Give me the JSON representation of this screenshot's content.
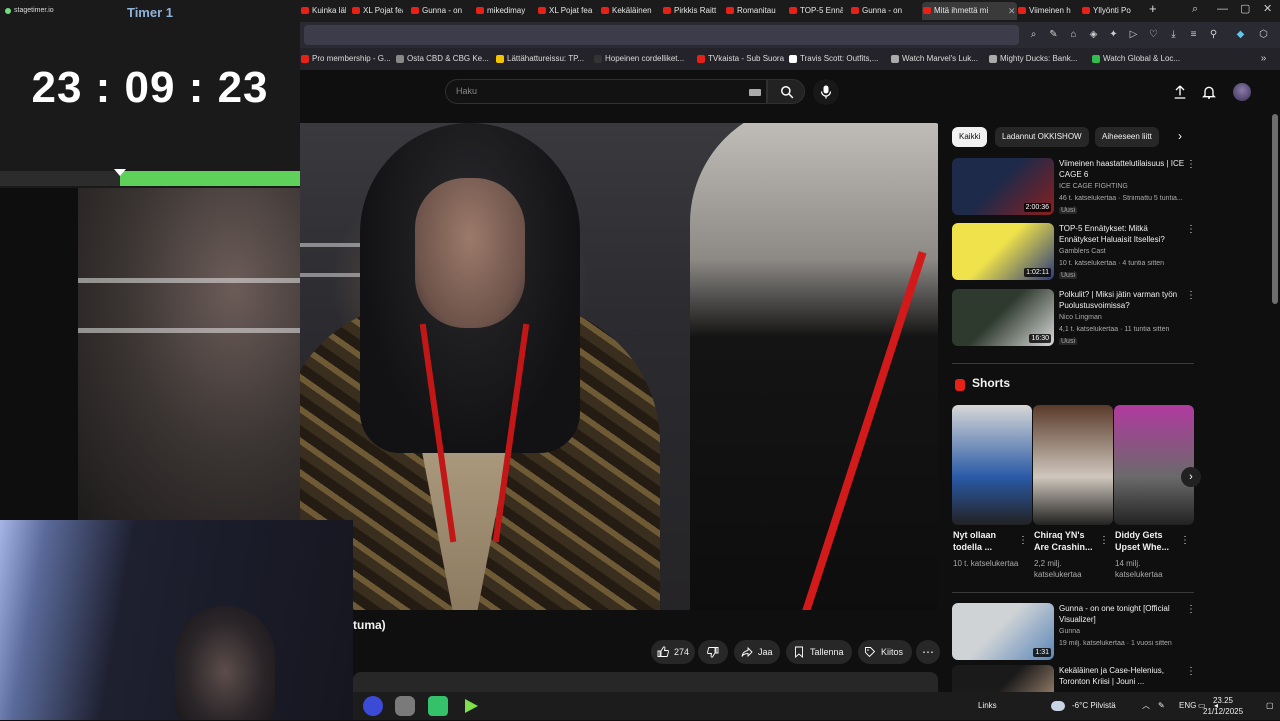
{
  "timer": {
    "brand": "stagetimer.io",
    "title": "Timer 1",
    "time": "23 : 09 : 23",
    "elapsed_fraction": 0.4
  },
  "browser": {
    "tabs": [
      {
        "label": "Kuinka lähe"
      },
      {
        "label": "XL Pojat fea"
      },
      {
        "label": "Gunna - on"
      },
      {
        "label": "mikedimay"
      },
      {
        "label": "XL Pojat fea"
      },
      {
        "label": "Kekäläinen"
      },
      {
        "label": "Pirkkis Raitt"
      },
      {
        "label": "Romanitau"
      },
      {
        "label": "TOP-5 Ennä"
      },
      {
        "label": "Gunna - on"
      },
      {
        "label": "Mitä ihmettä mi",
        "active": true
      },
      {
        "label": "Viimeinen h"
      },
      {
        "label": "Yllyönti Po"
      }
    ],
    "bookmarks": [
      {
        "label": "Pro membership - G...",
        "color": "#e62117"
      },
      {
        "label": "Osta CBD & CBG Ke...",
        "color": "#888888"
      },
      {
        "label": "Lättähattureissu: TP...",
        "color": "#f5c400"
      },
      {
        "label": "Hopeinen cordelliket...",
        "color": "#333333"
      },
      {
        "label": "TVkaista - Sub Suora",
        "color": "#e62117"
      },
      {
        "label": "Travis Scott: Outfits,...",
        "color": "#ffffff"
      },
      {
        "label": "Watch Marvel's Luk...",
        "color": "#aaaaaa"
      },
      {
        "label": "Mighty Ducks: Bank...",
        "color": "#aaaaaa"
      },
      {
        "label": "Watch Global & Loc...",
        "color": "#2fbf4a"
      }
    ]
  },
  "youtube": {
    "search_placeholder": "Haku",
    "video_title": "tuma)",
    "actions": {
      "likes": "274",
      "share": "Jaa",
      "save": "Tallenna",
      "thanks": "Kiitos"
    },
    "chips": [
      "Kaikki",
      "Ladannut OKKISHOW",
      "Aiheeseen liitt"
    ],
    "recommendations_top": [
      {
        "title": "Viimeinen haastattelutilaisuus | ICE CAGE 6",
        "channel": "ICE CAGE FIGHTING",
        "meta": "46 t. katselukertaa · Striimattu 5 tuntia...",
        "badge": "Uusi",
        "duration": "2:00:36",
        "thumb_colors": [
          "#1d2a4a",
          "#8a1f1f"
        ]
      },
      {
        "title": "TOP-5 Ennätykset: Mitkä Ennätykset Haluaisit Itsellesi?",
        "channel": "Gamblers Cast",
        "meta": "10 t. katselukertaa · 4 tuntia sitten",
        "badge": "Uusi",
        "duration": "1:02:11",
        "thumb_colors": [
          "#f0e24a",
          "#2a3a7a"
        ]
      },
      {
        "title": "Polkulit? | Miksi jätin varman työn Puolustusvoimissa?",
        "channel": "Nico Lingman",
        "meta": "4,1 t. katselukertaa · 11 tuntia sitten",
        "badge": "Uusi",
        "duration": "16:30",
        "thumb_colors": [
          "#2e3a2e",
          "#d9d9d9"
        ]
      }
    ],
    "shorts_heading": "Shorts",
    "shorts": [
      {
        "title": "Nyt ollaan todella ...",
        "views": "10 t. katselukertaa",
        "colors": [
          "#2a5aa6",
          "#d7d7d7"
        ]
      },
      {
        "title": "Chiraq YN's Are Crashin...",
        "views": "2,2 milj. katselukertaa",
        "colors": [
          "#cfc7bd",
          "#5a3a2a"
        ]
      },
      {
        "title": "Diddy Gets Upset Whe...",
        "views": "14 milj. katselukertaa",
        "colors": [
          "#6a6a6a",
          "#b23aa0"
        ]
      }
    ],
    "recommendations_bottom": [
      {
        "title": "Gunna - on one tonight [Official Visualizer]",
        "channel": "Gunna",
        "meta": "19 milj. katselukertaa · 1 vuosi sitten",
        "duration": "1:31",
        "thumb_colors": [
          "#cfd3d6",
          "#5a86b8"
        ]
      },
      {
        "title": "Kekäläinen ja Case-Helenius, Toronton Kriisi | Jouni ...",
        "channel": "",
        "meta": "",
        "duration": "",
        "thumb_colors": [
          "#1a1a1a",
          "#c7a58a"
        ]
      }
    ]
  },
  "taskbar": {
    "links": "Links",
    "weather": "-6°C  Pilvistä",
    "lang": "ENG",
    "time": "23.25",
    "date": "21/12/2025"
  }
}
